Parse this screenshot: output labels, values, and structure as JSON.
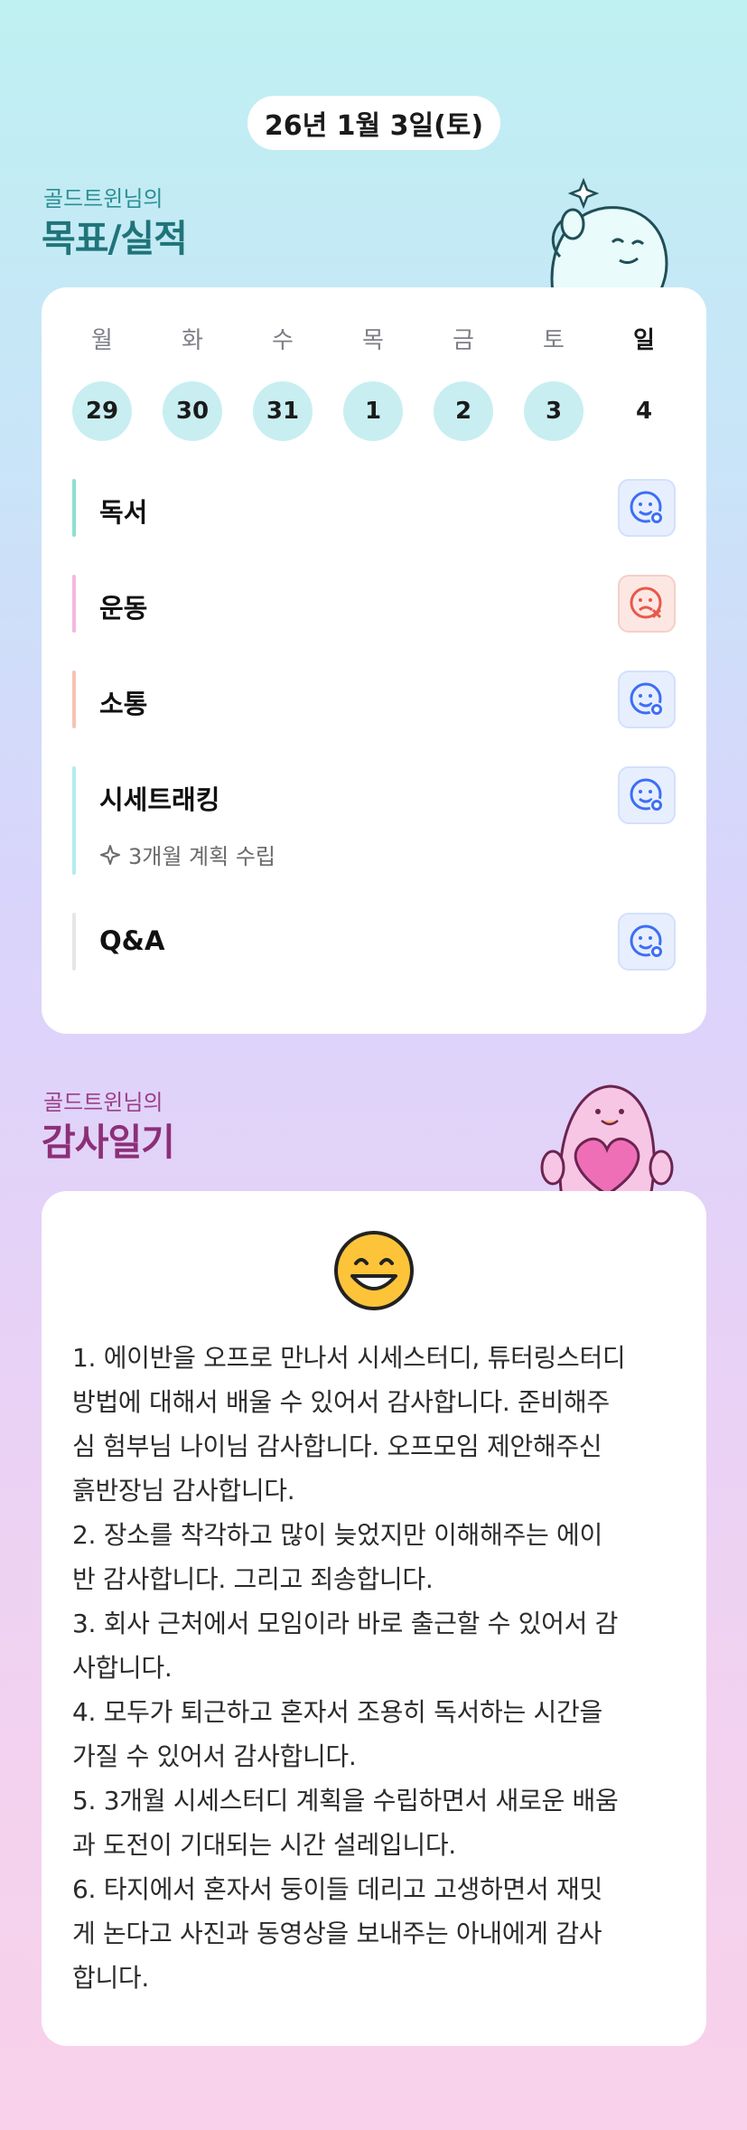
{
  "date": "26년 1월 3일(토)",
  "goals_section": {
    "subtitle": "골드트윈님의",
    "title": "목표/실적"
  },
  "week": {
    "days": [
      {
        "name": "월",
        "num": "29",
        "filled": true
      },
      {
        "name": "화",
        "num": "30",
        "filled": true
      },
      {
        "name": "수",
        "num": "31",
        "filled": true
      },
      {
        "name": "목",
        "num": "1",
        "filled": true
      },
      {
        "name": "금",
        "num": "2",
        "filled": true
      },
      {
        "name": "토",
        "num": "3",
        "filled": true
      },
      {
        "name": "일",
        "num": "4",
        "filled": false
      }
    ]
  },
  "goals": [
    {
      "label": "독서",
      "status": "done",
      "bar_color": "#8de0cf",
      "icon": "smile-check-icon"
    },
    {
      "label": "운동",
      "status": "missed",
      "bar_color": "#f4b7e0",
      "icon": "sad-x-icon"
    },
    {
      "label": "소통",
      "status": "done",
      "bar_color": "#f6c3b5",
      "icon": "smile-check-icon"
    },
    {
      "label": "시세트래킹",
      "sub": "3개월 계획 수립",
      "sub_icon": "sparkle-icon",
      "status": "done",
      "bar_color": "#b3ecef",
      "icon": "smile-check-icon"
    },
    {
      "label": "Q&A",
      "status": "done",
      "bar_color": "#e6e6ea",
      "icon": "smile-check-icon"
    }
  ],
  "diary_section": {
    "subtitle": "골드트윈님의",
    "title": "감사일기"
  },
  "diary": {
    "mood_icon": "grinning-face-icon",
    "lines": [
      "1. 에이반을 오프로 만나서 시세스터디, 튜터링스터디",
      "방법에 대해서 배울 수 있어서 감사합니다. 준비해주",
      "심 험부님 나이님 감사합니다. 오프모임 제안해주신",
      "흙반장님 감사합니다.",
      "2. 장소를 착각하고 많이 늦었지만 이해해주는 에이",
      "반 감사합니다. 그리고 죄송합니다.",
      "3. 회사 근처에서 모임이라 바로 출근할 수 있어서 감",
      "사합니다.",
      "4. 모두가 퇴근하고 혼자서 조용히 독서하는 시간을",
      "가질 수 있어서 감사합니다.",
      "5. 3개월 시세스터디 계획을 수립하면서 새로운 배움",
      "과 도전이 기대되는 시간 설레입니다.",
      "6. 타지에서 혼자서 둥이들 데리고 고생하면서 재밋",
      "게 논다고 사진과 동영상을 보내주는 아내에게 감사",
      "합니다."
    ]
  },
  "colors": {
    "teal_accent": "#1f7479",
    "magenta_accent": "#8c2f78",
    "day_circle": "#c8eef2",
    "check_blue": "#3d6ef5",
    "miss_red": "#e8584a"
  }
}
